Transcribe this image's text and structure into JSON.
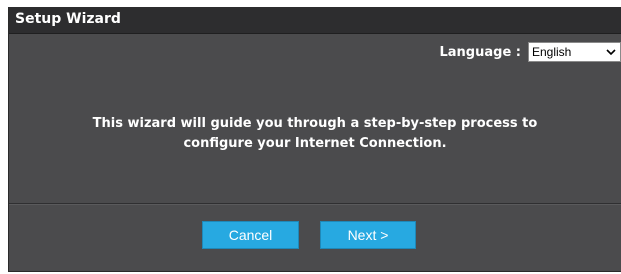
{
  "wizard": {
    "title": "Setup Wizard",
    "language_label": "Language :",
    "language_selected": "English",
    "message_line1": "This wizard will guide you through a step-by-step process to",
    "message_line2": "configure your Internet Connection.",
    "cancel_label": "Cancel",
    "next_label": "Next >"
  },
  "icons": {
    "language_dropdown": "chevron-down-icon"
  },
  "colors": {
    "panel_background": "#4b4b4d",
    "titlebar_background": "#2d2d2f",
    "button_background": "#27a9e1",
    "text": "#ffffff"
  }
}
